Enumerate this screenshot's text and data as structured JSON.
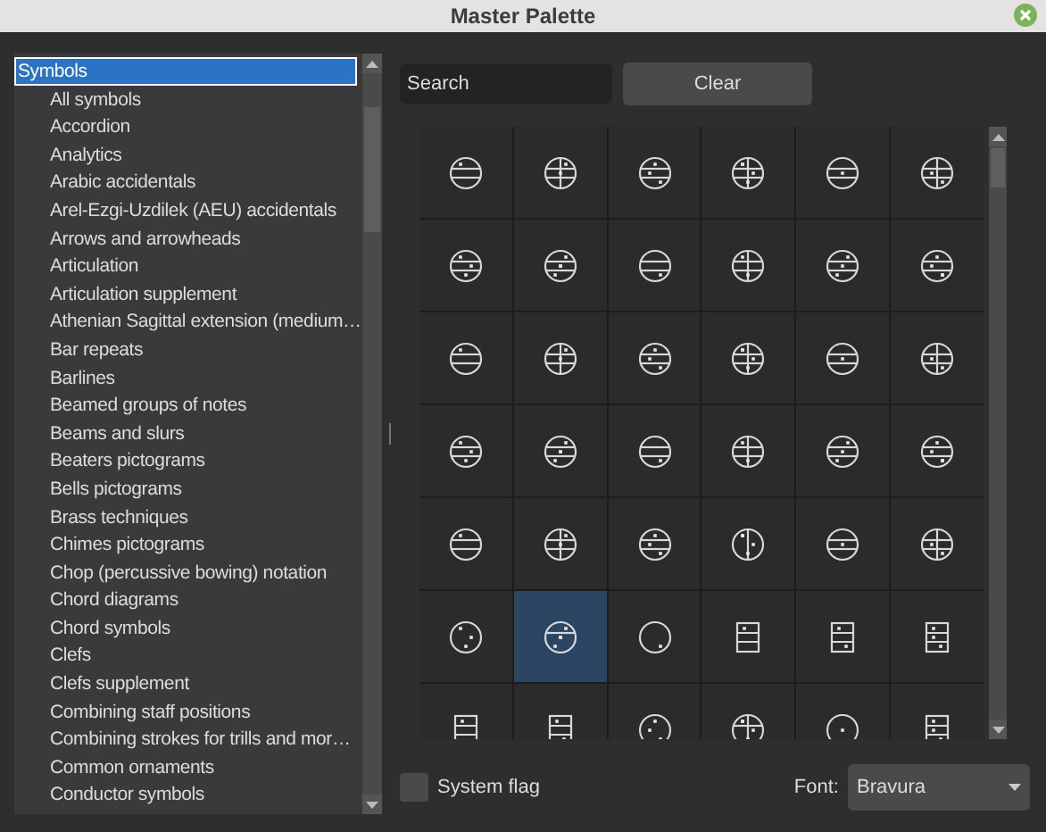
{
  "window": {
    "title": "Master Palette"
  },
  "categories": {
    "label": "Symbols",
    "selected": true,
    "children": [
      {
        "label": "All symbols",
        "selected": false
      },
      {
        "label": "Accordion",
        "selected": false
      },
      {
        "label": "Analytics",
        "selected": false
      },
      {
        "label": "Arabic accidentals",
        "selected": false
      },
      {
        "label": "Arel-Ezgi-Uzdilek (AEU) accidentals",
        "selected": false
      },
      {
        "label": "Arrows and arrowheads",
        "selected": false
      },
      {
        "label": "Articulation",
        "selected": false
      },
      {
        "label": "Articulation supplement",
        "selected": false
      },
      {
        "label": "Athenian Sagittal extension (medium…",
        "selected": false
      },
      {
        "label": "Bar repeats",
        "selected": false
      },
      {
        "label": "Barlines",
        "selected": false
      },
      {
        "label": "Beamed groups of notes",
        "selected": false
      },
      {
        "label": "Beams and slurs",
        "selected": false
      },
      {
        "label": "Beaters pictograms",
        "selected": false
      },
      {
        "label": "Bells pictograms",
        "selected": false
      },
      {
        "label": "Brass techniques",
        "selected": false
      },
      {
        "label": "Chimes pictograms",
        "selected": false
      },
      {
        "label": "Chop (percussive bowing) notation",
        "selected": false
      },
      {
        "label": "Chord diagrams",
        "selected": false
      },
      {
        "label": "Chord symbols",
        "selected": false
      },
      {
        "label": "Clefs",
        "selected": false
      },
      {
        "label": "Clefs supplement",
        "selected": false
      },
      {
        "label": "Combining staff positions",
        "selected": false
      },
      {
        "label": "Combining strokes for trills and mor…",
        "selected": false
      },
      {
        "label": "Common ornaments",
        "selected": false
      },
      {
        "label": "Conductor symbols",
        "selected": false
      }
    ]
  },
  "search": {
    "placeholder": "Search"
  },
  "clear_button": "Clear",
  "symbols": [
    {
      "kind": "circle",
      "selected": false
    },
    {
      "kind": "circle",
      "selected": false
    },
    {
      "kind": "circle",
      "selected": false
    },
    {
      "kind": "circle",
      "selected": false
    },
    {
      "kind": "circle",
      "selected": false
    },
    {
      "kind": "circle",
      "selected": false
    },
    {
      "kind": "circle",
      "selected": false
    },
    {
      "kind": "circle",
      "selected": false
    },
    {
      "kind": "circle",
      "selected": false
    },
    {
      "kind": "circle",
      "selected": false
    },
    {
      "kind": "circle",
      "selected": false
    },
    {
      "kind": "circle",
      "selected": false
    },
    {
      "kind": "circle",
      "selected": false
    },
    {
      "kind": "circle",
      "selected": false
    },
    {
      "kind": "circle",
      "selected": false
    },
    {
      "kind": "circle",
      "selected": false
    },
    {
      "kind": "circle",
      "selected": false
    },
    {
      "kind": "circle",
      "selected": false
    },
    {
      "kind": "circle",
      "selected": false
    },
    {
      "kind": "circle",
      "selected": false
    },
    {
      "kind": "circle",
      "selected": false
    },
    {
      "kind": "circle",
      "selected": false
    },
    {
      "kind": "circle",
      "selected": false
    },
    {
      "kind": "circle",
      "selected": false
    },
    {
      "kind": "circle",
      "selected": false
    },
    {
      "kind": "circle",
      "selected": false
    },
    {
      "kind": "circle",
      "selected": false
    },
    {
      "kind": "circle",
      "selected": false
    },
    {
      "kind": "circle",
      "selected": false
    },
    {
      "kind": "circle",
      "selected": false
    },
    {
      "kind": "circle",
      "selected": false
    },
    {
      "kind": "circle",
      "selected": true
    },
    {
      "kind": "circle",
      "selected": false
    },
    {
      "kind": "box",
      "selected": false
    },
    {
      "kind": "box",
      "selected": false
    },
    {
      "kind": "box",
      "selected": false
    },
    {
      "kind": "box",
      "selected": false
    },
    {
      "kind": "box",
      "selected": false
    },
    {
      "kind": "circle",
      "selected": false
    },
    {
      "kind": "circle",
      "selected": false
    },
    {
      "kind": "circle",
      "selected": false
    },
    {
      "kind": "box",
      "selected": false
    }
  ],
  "system_flag": {
    "label": "System flag",
    "checked": false
  },
  "font": {
    "label": "Font:",
    "value": "Bravura"
  }
}
